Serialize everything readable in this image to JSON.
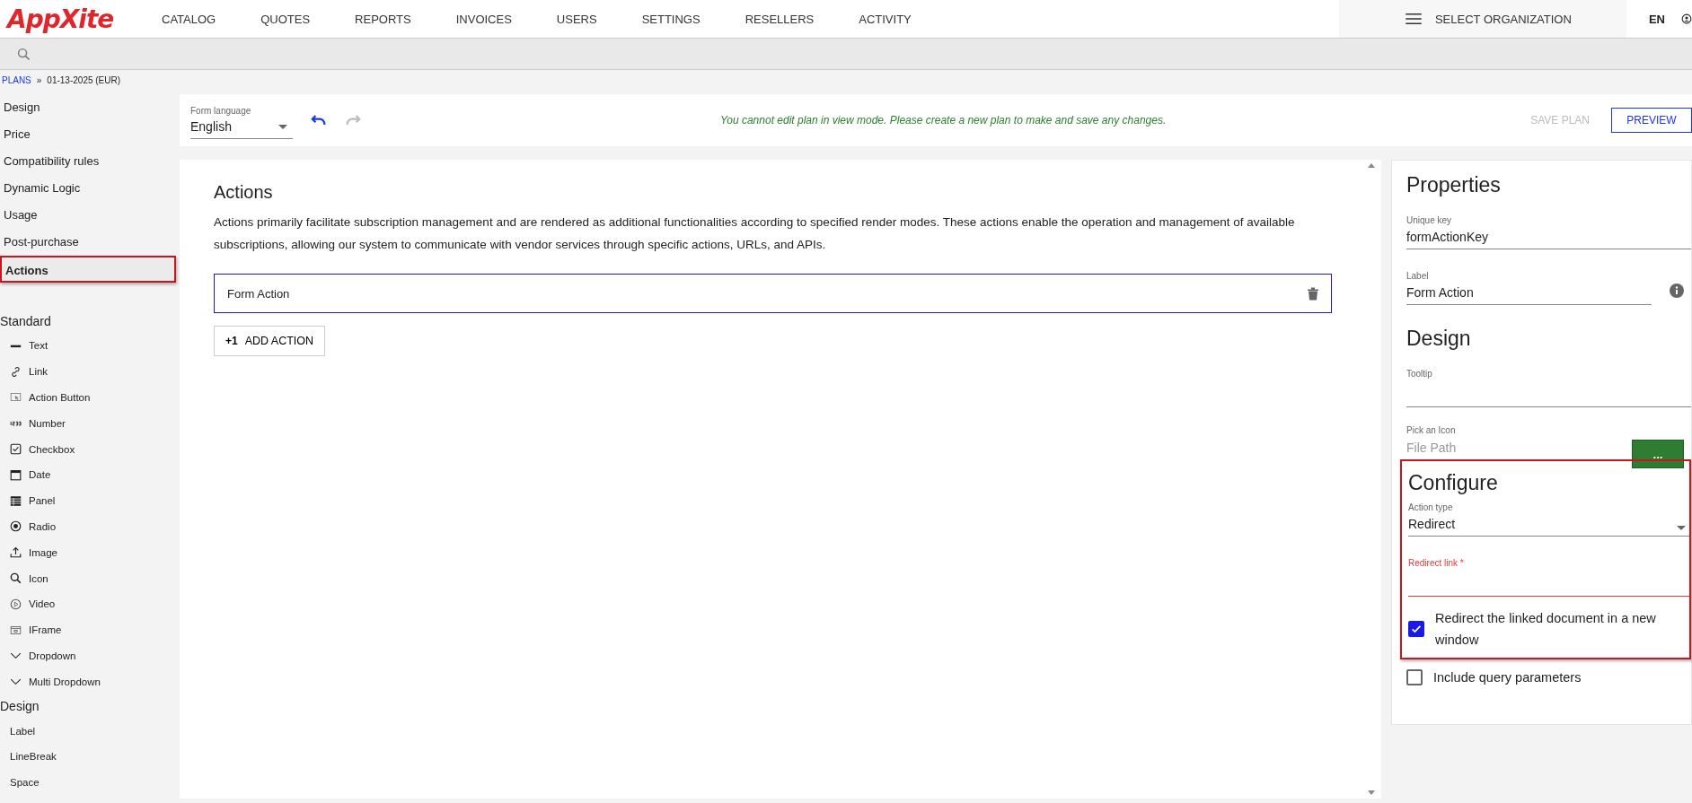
{
  "logo": {
    "text": "AppXite"
  },
  "nav": [
    {
      "label": "CATALOG"
    },
    {
      "label": "QUOTES"
    },
    {
      "label": "REPORTS"
    },
    {
      "label": "INVOICES"
    },
    {
      "label": "USERS"
    },
    {
      "label": "SETTINGS"
    },
    {
      "label": "RESELLERS"
    },
    {
      "label": "ACTIVITY"
    }
  ],
  "org_selector": {
    "label": "SELECT ORGANIZATION"
  },
  "language": "EN",
  "breadcrumb": {
    "link": "PLANS",
    "separator": "»",
    "current": "01-13-2025 (EUR)"
  },
  "sidebar": {
    "items": [
      {
        "label": "Design",
        "selected": false,
        "highlighted": false
      },
      {
        "label": "Price",
        "selected": false,
        "highlighted": false
      },
      {
        "label": "Compatibility rules",
        "selected": false,
        "highlighted": false
      },
      {
        "label": "Dynamic Logic",
        "selected": false,
        "highlighted": false
      },
      {
        "label": "Usage",
        "selected": false,
        "highlighted": false
      },
      {
        "label": "Post-purchase",
        "selected": false,
        "highlighted": false
      },
      {
        "label": "Actions",
        "selected": true,
        "highlighted": true
      }
    ],
    "groups": [
      {
        "title": "Standard",
        "items": [
          {
            "label": "Text",
            "kind": "text"
          },
          {
            "label": "Link",
            "kind": "link"
          },
          {
            "label": "Action Button",
            "kind": "action-button"
          },
          {
            "label": "Number",
            "kind": "number"
          },
          {
            "label": "Checkbox",
            "kind": "checkbox"
          },
          {
            "label": "Date",
            "kind": "date"
          },
          {
            "label": "Panel",
            "kind": "panel"
          },
          {
            "label": "Radio",
            "kind": "radio"
          },
          {
            "label": "Image",
            "kind": "image"
          },
          {
            "label": "Icon",
            "kind": "icon"
          },
          {
            "label": "Video",
            "kind": "video"
          },
          {
            "label": "IFrame",
            "kind": "iframe"
          },
          {
            "label": "Dropdown",
            "kind": "dropdown"
          },
          {
            "label": "Multi Dropdown",
            "kind": "dropdown"
          }
        ]
      },
      {
        "title": "Design",
        "items": [
          {
            "label": "Label",
            "kind": "plain"
          },
          {
            "label": "LineBreak",
            "kind": "plain"
          },
          {
            "label": "Space",
            "kind": "plain"
          }
        ]
      }
    ]
  },
  "toolbar": {
    "language_label": "Form language",
    "language_value": "English",
    "undo": {
      "disabled": false
    },
    "redo": {
      "disabled": true
    },
    "notice": "You cannot edit plan in view mode. Please create a new plan to make and save any changes.",
    "save_button": {
      "label": "SAVE PLAN",
      "disabled": true
    },
    "preview_button": {
      "label": "PREVIEW"
    }
  },
  "main": {
    "title": "Actions",
    "description": "Actions primarily facilitate subscription management and are rendered as additional functionalities according to specified render modes. These actions enable the operation and management of available subscriptions, allowing our system to communicate with vendor services through specific actions, URLs, and APIs.",
    "actions": [
      {
        "label": "Form Action",
        "selected": true
      }
    ],
    "add_button": {
      "prefix": "+1",
      "label": "ADD ACTION"
    }
  },
  "properties": {
    "title": "Properties",
    "unique_key": {
      "label": "Unique key",
      "value": "formActionKey"
    },
    "label_field": {
      "label": "Label",
      "value": "Form Action"
    },
    "design_title": "Design",
    "tooltip": {
      "label": "Tooltip"
    },
    "icon_picker": {
      "label": "Pick an Icon",
      "placeholder": "File Path",
      "button": "..."
    },
    "configure": {
      "title": "Configure",
      "highlighted": true,
      "action_type": {
        "label": "Action type",
        "value": "Redirect"
      },
      "redirect_link": {
        "label": "Redirect link",
        "required_mark": "*",
        "invalid": true
      },
      "options": [
        {
          "label": "Redirect the linked document in a new window",
          "checked": true
        }
      ]
    },
    "more_options": [
      {
        "label": "Include query parameters",
        "checked": false
      }
    ]
  }
}
